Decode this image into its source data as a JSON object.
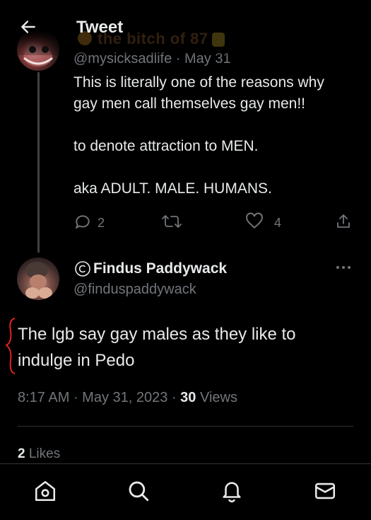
{
  "header": {
    "title": "Tweet",
    "back_icon": "arrow-left-icon",
    "obscured_author_name": "the bitch of 87"
  },
  "parent_tweet": {
    "handle_line": "@mysicksadlife · May 31",
    "lines": [
      "This is literally one of the reasons why",
      "gay men call themselves gay men!!",
      "",
      "to denote attraction to MEN.",
      "",
      "aka ADULT. MALE. HUMANS."
    ],
    "actions": {
      "reply_count": "2",
      "retweet_count": "",
      "like_count": "4"
    }
  },
  "reply_tweet": {
    "display_name": "Findus Paddywack",
    "handle": "@finduspaddywack",
    "text_lines": [
      "The lgb say gay males as they like to",
      "indulge in Pedo"
    ],
    "time": "8:17 AM",
    "date": "May 31, 2023",
    "views_count": "30",
    "views_label": "Views",
    "likes_count": "2",
    "likes_label": "Likes"
  },
  "bottom_nav": {
    "items": [
      "home-icon",
      "search-icon",
      "notifications-icon",
      "messages-icon"
    ]
  },
  "colors": {
    "background": "#000000",
    "text_primary": "#e7e9ea",
    "text_secondary": "#71767b",
    "divider": "#2f3336",
    "annotation_red": "#e0221d"
  }
}
